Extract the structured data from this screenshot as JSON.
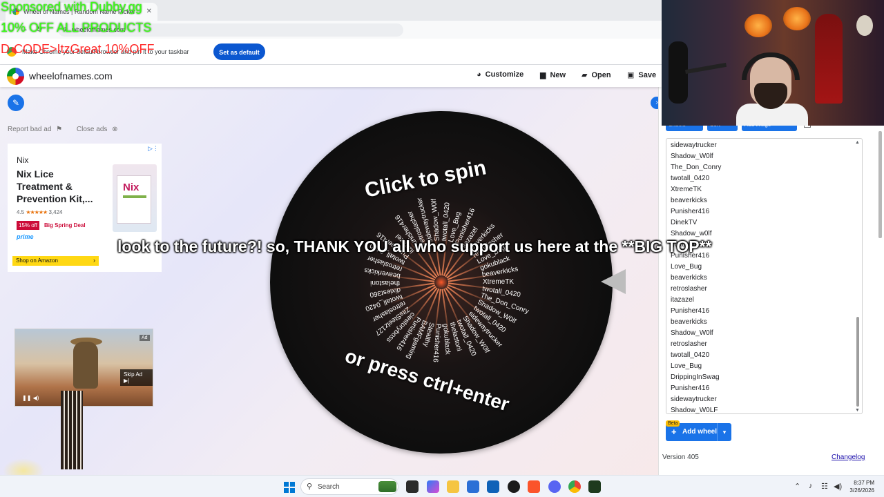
{
  "browser": {
    "tab_title": "Wheel of Names | Random Name Picker",
    "url": "wheelofnames.com",
    "infobar_text": "Make Chrome your default browser and pin it to your taskbar",
    "set_default_label": "Set as default"
  },
  "app": {
    "site_name": "wheelofnames.com",
    "menu": [
      {
        "label": "Customize",
        "icon": "palette-icon"
      },
      {
        "label": "New",
        "icon": "file-icon"
      },
      {
        "label": "Open",
        "icon": "folder-icon"
      },
      {
        "label": "Save",
        "icon": "floppy-icon"
      }
    ]
  },
  "ads": {
    "report_label": "Report bad ad",
    "close_label": "Close ads",
    "brand": "Nix",
    "title": "Nix Lice Treatment & Prevention Kit,...",
    "rating": "4.5",
    "stars": "★★★★★",
    "review_count": "3,424",
    "discount": "15% off",
    "deal": "Big Spring Deal",
    "prime": "prime",
    "product_name": "Nix",
    "shop_label": "Shop on Amazon",
    "video_skip_label": "Skip Ad",
    "video_tag": "Ad"
  },
  "wheel": {
    "click_label": "Click to spin",
    "press_label": "or press ctrl+enter",
    "spokes": [
      "XtremeTK",
      "twotall_0420",
      "The_Don_Conry",
      "Shadow_W0lf",
      "twotall_0420",
      "sidewaytrucker",
      "Shadow_W0lf",
      "twotall_0420",
      "thelastoni",
      "gokublack",
      "Punisher416",
      "Stealthy",
      "BAMFgaming",
      "Punisher416",
      "ciestoryboss",
      "ZitsSteelz127",
      "retroslasher",
      "twotall_0420",
      "dixiest360",
      "thelastoni",
      "beaverkicks",
      "retroslasher",
      "twotall_0420",
      "Punisher416",
      "itazazel",
      "Punisher416",
      "retroslasher",
      "sidewaytrucker",
      "Shadow_W0lf",
      "twotall_0420",
      "Love_Bug",
      "Punisher416",
      "itazazel",
      "beaverkicks",
      "retroslasher",
      "Love_Bug",
      "gokublack",
      "beaverkicks"
    ]
  },
  "entries_panel": {
    "toolbar": [
      "Shuffle",
      "Sort",
      "Add image"
    ],
    "advanced_label": "Advanced",
    "entries": [
      "sidewaytrucker",
      "Shadow_W0lf",
      "The_Don_Conry",
      "twotall_0420",
      "XtremeTK",
      "beaverkicks",
      "Punisher416",
      "DinekTV",
      "Shadow_w0lf",
      "gokublack",
      "Punisher416",
      "Love_Bug",
      "beaverkicks",
      "retroslasher",
      "itazazel",
      "Punisher416",
      "beaverkicks",
      "Shadow_W0lf",
      "retroslasher",
      "twotall_0420",
      "Love_Bug",
      "DrippingInSwag",
      "Punisher416",
      "sidewaytrucker",
      "Shadow_W0LF"
    ],
    "add_wheel_label": "Add wheel",
    "beta_label": "Beta",
    "version": "Version 405",
    "changelog_label": "Changelog"
  },
  "overlays": {
    "sponsor_line": "Sponsored with Dubby.gg",
    "discount_line": "10% OFF ALL PRODUCTS",
    "code_line": "D-CODE>ItzGreat 10%OFF",
    "caption": "look to the future?! so, THANK YOU all who support us here at the **BIG TOP**"
  },
  "taskbar": {
    "search_placeholder": "Search",
    "time": "8:37 PM",
    "date": "3/26/2026"
  }
}
